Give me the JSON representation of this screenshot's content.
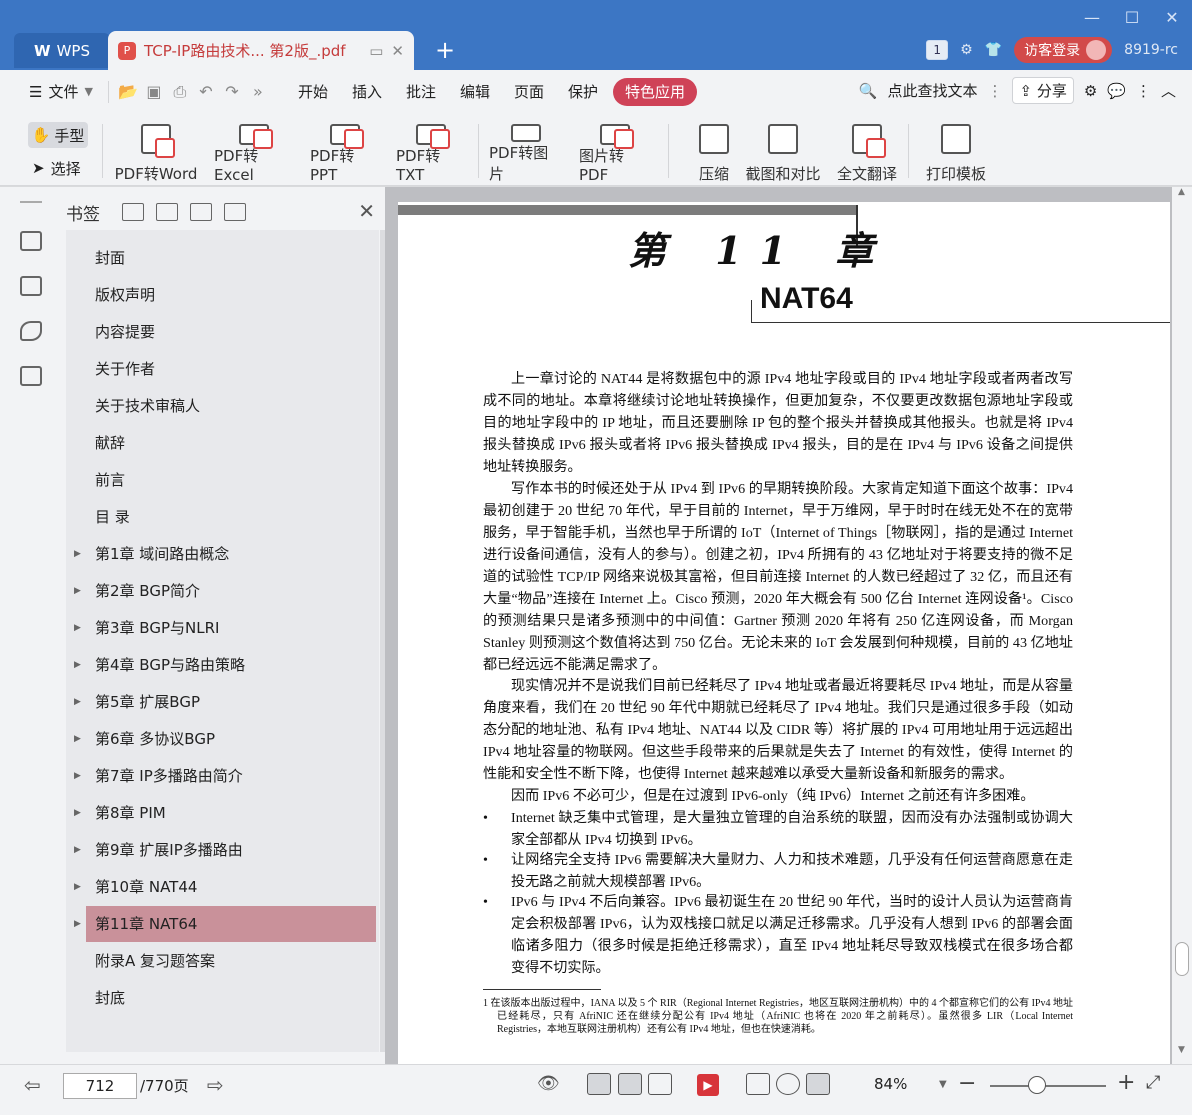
{
  "titlebar": {
    "app_tab": "WPS",
    "doc_tab": "TCP-IP路由技术... 第2版_.pdf",
    "page_badge": "1",
    "visitor_label": "访客登录",
    "user_id": "8919-rc"
  },
  "menubar": {
    "file": "文件",
    "items": [
      "开始",
      "插入",
      "批注",
      "编辑",
      "页面",
      "保护"
    ],
    "special": "特色应用",
    "search": "点此查找文本",
    "share": "分享"
  },
  "ribbon": {
    "hand": "手型",
    "select": "选择",
    "buttons": [
      "PDF转Word",
      "PDF转Excel",
      "PDF转PPT",
      "PDF转TXT",
      "PDF转图片",
      "图片转PDF",
      "压缩",
      "截图和对比",
      "全文翻译",
      "打印模板"
    ]
  },
  "bookmarks": {
    "title": "书签",
    "items": [
      {
        "label": "封面"
      },
      {
        "label": "版权声明"
      },
      {
        "label": "内容提要"
      },
      {
        "label": "关于作者"
      },
      {
        "label": "关于技术审稿人"
      },
      {
        "label": "献辞"
      },
      {
        "label": "前言"
      },
      {
        "label": "目 录"
      },
      {
        "label": "第1章  域间路由概念"
      },
      {
        "label": "第2章  BGP简介"
      },
      {
        "label": "第3章  BGP与NLRI"
      },
      {
        "label": "第4章  BGP与路由策略"
      },
      {
        "label": "第5章  扩展BGP"
      },
      {
        "label": "第6章  多协议BGP"
      },
      {
        "label": "第7章  IP多播路由简介"
      },
      {
        "label": "第8章  PIM"
      },
      {
        "label": "第9章  扩展IP多播路由"
      },
      {
        "label": "第10章  NAT44"
      },
      {
        "label": "第11章  NAT64"
      },
      {
        "label": "附录A  复习题答案"
      },
      {
        "label": "封底"
      }
    ],
    "selected_index": 18
  },
  "document": {
    "chapter": "第 11 章",
    "chapter_title": "NAT64",
    "paragraphs": [
      "上一章讨论的 NAT44 是将数据包中的源 IPv4 地址字段或目的 IPv4 地址字段或者两者改写成不同的地址。本章将继续讨论地址转换操作，但更加复杂，不仅要更改数据包源地址字段或目的地址字段中的 IP 地址，而且还要删除 IP 包的整个报头并替换成其他报头。也就是将 IPv4 报头替换成 IPv6 报头或者将 IPv6 报头替换成 IPv4 报头，目的是在 IPv4 与 IPv6 设备之间提供地址转换服务。",
      "写作本书的时候还处于从 IPv4 到 IPv6 的早期转换阶段。大家肯定知道下面这个故事：IPv4 最初创建于 20 世纪 70 年代，早于目前的 Internet，早于万维网，早于时时在线无处不在的宽带服务，早于智能手机，当然也早于所谓的 IoT（Internet of Things［物联网］，指的是通过 Internet 进行设备间通信，没有人的参与）。创建之初，IPv4 所拥有的 43 亿地址对于将要支持的微不足道的试验性 TCP/IP 网络来说极其富裕，但目前连接 Internet 的人数已经超过了 32 亿，而且还有大量“物品”连接在 Internet 上。Cisco 预测，2020 年大概会有 500 亿台 Internet 连网设备¹。Cisco 的预测结果只是诸多预测中的中间值：Gartner 预测 2020 年将有 250 亿连网设备，而 Morgan Stanley 则预测这个数值将达到 750 亿台。无论未来的 IoT 会发展到何种规模，目前的 43 亿地址都已经远远不能满足需求了。",
      "现实情况并不是说我们目前已经耗尽了 IPv4 地址或者最近将要耗尽 IPv4 地址，而是从容量角度来看，我们在 20 世纪 90 年代中期就已经耗尽了 IPv4 地址。我们只是通过很多手段（如动态分配的地址池、私有 IPv4 地址、NAT44 以及 CIDR 等）将扩展的 IPv4 可用地址用于远远超出 IPv4 地址容量的物联网。但这些手段带来的后果就是失去了 Internet 的有效性，使得 Internet 的性能和安全性不断下降，也使得 Internet 越来越难以承受大量新设备和新服务的需求。",
      "因而 IPv6 不必可少，但是在过渡到 IPv6-only（纯 IPv6）Internet 之前还有许多困难。"
    ],
    "bullets": [
      "Internet 缺乏集中式管理，是大量独立管理的自治系统的联盟，因而没有办法强制或协调大家全部都从 IPv4 切换到 IPv6。",
      "让网络完全支持 IPv6 需要解决大量财力、人力和技术难题，几乎没有任何运营商愿意在走投无路之前就大规模部署 IPv6。",
      "IPv6 与 IPv4 不后向兼容。IPv6 最初诞生在 20 世纪 90 年代，当时的设计人员认为运营商肯定会积极部署 IPv6，认为双栈接口就足以满足迁移需求。几乎没有人想到 IPv6 的部署会面临诸多阻力（很多时候是拒绝迁移需求），直至 IPv4 地址耗尽导致双栈模式在很多场合都变得不切实际。"
    ],
    "footnote": "1  在该版本出版过程中，IANA 以及 5 个 RIR（Regional Internet Registries，地区互联网注册机构）中的 4 个都宣称它们的公有 IPv4 地址已经耗尽，只有 AfriNIC 还在继续分配公有 IPv4 地址（AfriNIC 也将在 2020 年之前耗尽）。虽然很多 LIR（Local Internet Registries，本地互联网注册机构）还有公有 IPv4 地址，但也在快速消耗。"
  },
  "statusbar": {
    "page_current": "712",
    "page_total": "/770页",
    "zoom": "84%"
  }
}
